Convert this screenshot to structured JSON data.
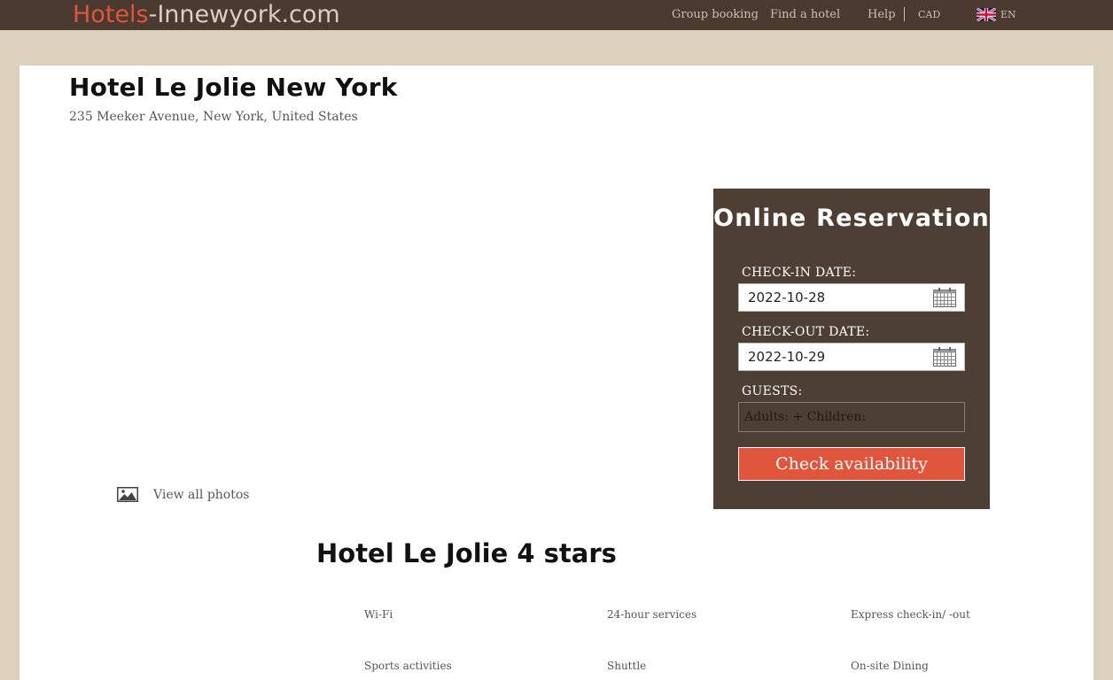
{
  "header": {
    "logo_accent": "Hotels",
    "logo_rest": "-Innewyork.com",
    "nav": {
      "group_booking": "Group booking",
      "find_hotel": "Find a hotel",
      "help": "Help",
      "currency": "CAD",
      "language": "EN"
    },
    "flag_icon": "uk-flag-icon"
  },
  "hotel": {
    "name": "Hotel Le Jolie New York",
    "address": "235 Meeker Avenue, New York, United States",
    "view_photos": "View all photos",
    "photos_icon": "image-icon"
  },
  "reservation": {
    "title": "Online Reservation",
    "checkin_label": "CHECK-IN DATE:",
    "checkin_value": "2022-10-28",
    "checkout_label": "CHECK-OUT DATE:",
    "checkout_value": "2022-10-29",
    "guests_label": "GUESTS:",
    "guests_value": "Adults: + Children:",
    "button_label": "Check availability",
    "calendar_icon": "calendar-icon"
  },
  "details": {
    "title": "Hotel Le Jolie 4 stars",
    "amenities": [
      "Wi-Fi",
      "24-hour services",
      "Express check-in/ -out",
      "Sports activities",
      "Shuttle",
      "On-site Dining"
    ]
  },
  "colors": {
    "topbar": "#4a3a30",
    "accent": "#e0563c",
    "reservation_bg": "#4e3f34",
    "page_bg": "#dcd1bd"
  }
}
